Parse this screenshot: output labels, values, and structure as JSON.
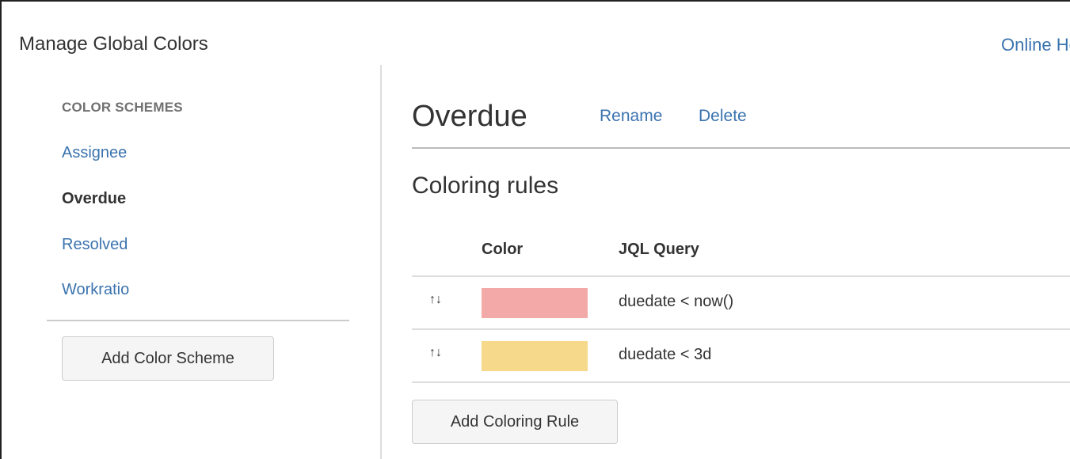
{
  "header": {
    "title": "Manage Global Colors",
    "help_link": "Online Help"
  },
  "sidebar": {
    "heading": "COLOR SCHEMES",
    "items": [
      {
        "label": "Assignee",
        "active": false
      },
      {
        "label": "Overdue",
        "active": true
      },
      {
        "label": "Resolved",
        "active": false
      },
      {
        "label": "Workratio",
        "active": false
      }
    ],
    "add_button": "Add Color Scheme"
  },
  "main": {
    "scheme_title": "Overdue",
    "rename_link": "Rename",
    "delete_link": "Delete",
    "section_title": "Coloring rules",
    "table": {
      "columns": [
        "Color",
        "JQL Query"
      ],
      "rows": [
        {
          "handle_icon": "reorder-arrows-icon",
          "color": "#f2a9a7",
          "query": "duedate < now()"
        },
        {
          "handle_icon": "reorder-arrows-icon",
          "color": "#f7d98c",
          "query": "duedate < 3d"
        }
      ]
    },
    "add_button": "Add Coloring Rule"
  },
  "colors": {
    "link": "#3b73af",
    "text": "#333333",
    "muted": "#707070"
  }
}
